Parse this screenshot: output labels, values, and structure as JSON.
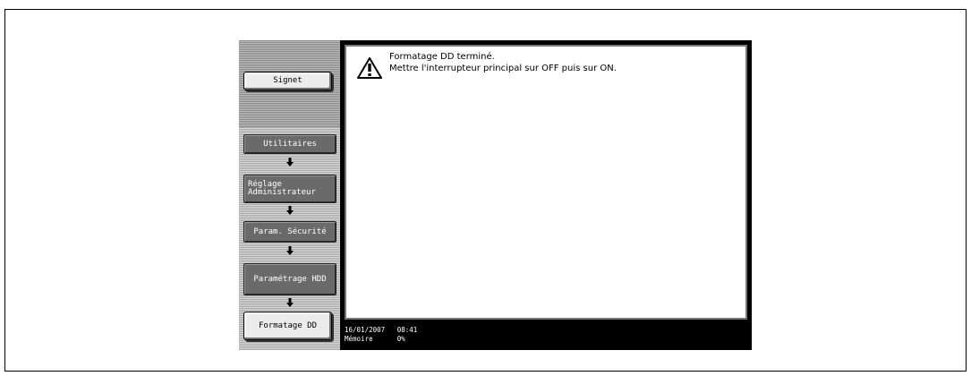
{
  "sidebar": {
    "bookmark_label": "Signet",
    "breadcrumb": [
      {
        "label": "Utilitaires"
      },
      {
        "label": "Réglage\nAdministrateur"
      },
      {
        "label": "Param. Sécurité"
      },
      {
        "label": "Paramétrage HDD"
      },
      {
        "label": "Formatage DD"
      }
    ]
  },
  "message": {
    "line1": "Formatage DD terminé.",
    "line2": "Mettre l'interrupteur principal sur OFF puis sur ON."
  },
  "status": {
    "date": "16/01/2007",
    "time": "08:41",
    "memory_label": "Mémoire",
    "memory_value": "0%"
  }
}
